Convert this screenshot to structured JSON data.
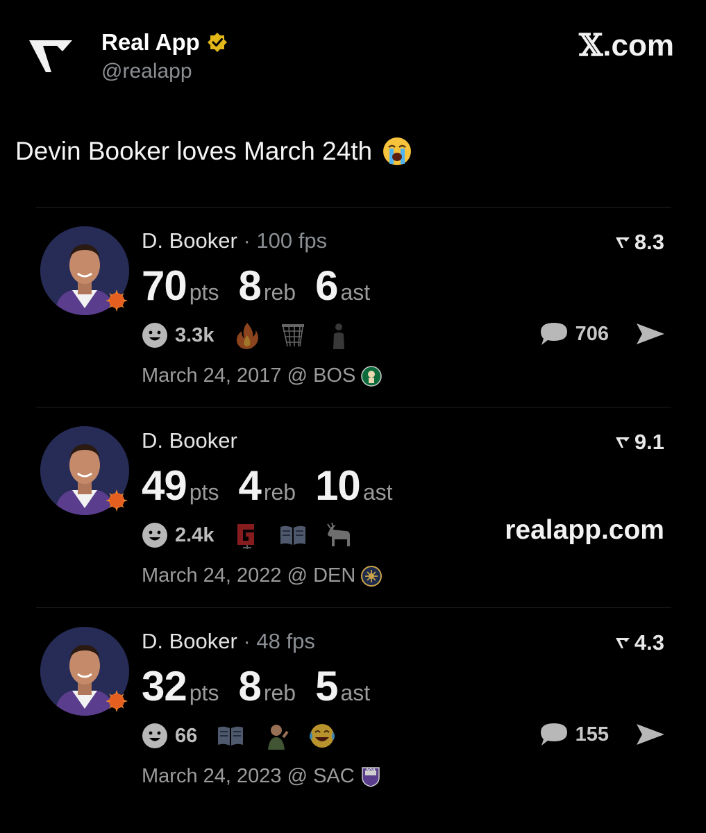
{
  "header": {
    "account_name": "Real App",
    "handle": "@realapp",
    "watermark_x": "𝕏",
    "watermark_rest": ".com"
  },
  "tweet": {
    "text": "Devin Booker loves March 24th",
    "emoji": "loudly-crying-face"
  },
  "cards": [
    {
      "player": "D. Booker",
      "separator": " · ",
      "fps": "100 fps",
      "rating": "8.3",
      "pts": "70",
      "pts_label": "pts",
      "reb": "8",
      "reb_label": "reb",
      "ast": "6",
      "ast_label": "ast",
      "reaction_count": "3.3k",
      "reaction_icons": [
        "fire-icon",
        "basketball-net-icon",
        "person-icon"
      ],
      "comment_count": "706",
      "date": "March 24, 2017 @ BOS",
      "team_logo": "celtics-logo"
    },
    {
      "player": "D. Booker",
      "rating": "9.1",
      "pts": "49",
      "pts_label": "pts",
      "reb": "4",
      "reb_label": "reb",
      "ast": "10",
      "ast_label": "ast",
      "reaction_count": "2.4k",
      "reaction_icons": [
        "letter-g-icon",
        "book-icon",
        "goat-icon"
      ],
      "link": "realapp.com",
      "date": "March 24, 2022 @ DEN",
      "team_logo": "nuggets-logo"
    },
    {
      "player": "D. Booker",
      "separator": " · ",
      "fps": "48 fps",
      "rating": "4.3",
      "pts": "32",
      "pts_label": "pts",
      "reb": "8",
      "reb_label": "reb",
      "ast": "5",
      "ast_label": "ast",
      "reaction_count": "66",
      "reaction_icons": [
        "book-icon",
        "baby-icon",
        "tears-of-joy-icon"
      ],
      "comment_count": "155",
      "date": "March 24, 2023 @ SAC",
      "team_logo": "kings-logo"
    }
  ],
  "colors": {
    "background": "#000000",
    "verified_gold": "#e2b719",
    "avatar_bg": "#272c57",
    "suns_orange": "#e56020",
    "jersey_purple": "#5a3d8c"
  }
}
